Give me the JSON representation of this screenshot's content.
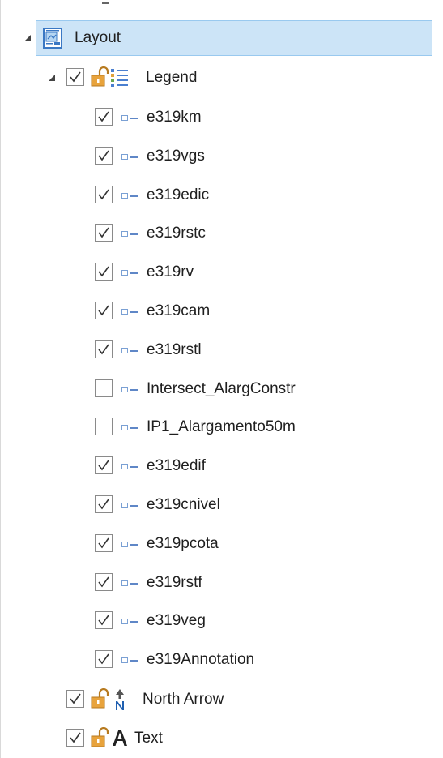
{
  "layout": {
    "label": "Layout",
    "expanded": true,
    "selected": true
  },
  "legend": {
    "label": "Legend",
    "checked": true,
    "expanded": true,
    "items": [
      {
        "label": "e319km",
        "checked": true
      },
      {
        "label": "e319vgs",
        "checked": true
      },
      {
        "label": "e319edic",
        "checked": true
      },
      {
        "label": "e319rstc",
        "checked": true
      },
      {
        "label": "e319rv",
        "checked": true
      },
      {
        "label": "e319cam",
        "checked": true
      },
      {
        "label": "e319rstl",
        "checked": true
      },
      {
        "label": "Intersect_AlargConstr",
        "checked": false
      },
      {
        "label": "IP1_Alargamento50m",
        "checked": false
      },
      {
        "label": "e319edif",
        "checked": true
      },
      {
        "label": "e319cnivel",
        "checked": true
      },
      {
        "label": "e319pcota",
        "checked": true
      },
      {
        "label": "e319rstf",
        "checked": true
      },
      {
        "label": "e319veg",
        "checked": true
      },
      {
        "label": "e319Annotation",
        "checked": true
      }
    ]
  },
  "north_arrow": {
    "label": "North Arrow",
    "checked": true
  },
  "text_element": {
    "label": "Text",
    "checked": true
  },
  "icons": {
    "layout": "layout-page-icon",
    "legend": "legend-list-icon",
    "lock": "unlock-padlock-icon",
    "legend_patch": "legend-patch-icon",
    "north_arrow": "north-arrow-icon",
    "text": "text-A-icon"
  },
  "colors": {
    "selection_bg": "#cce4f7",
    "selection_border": "#99c9ef",
    "lock": "#e8a33c"
  }
}
